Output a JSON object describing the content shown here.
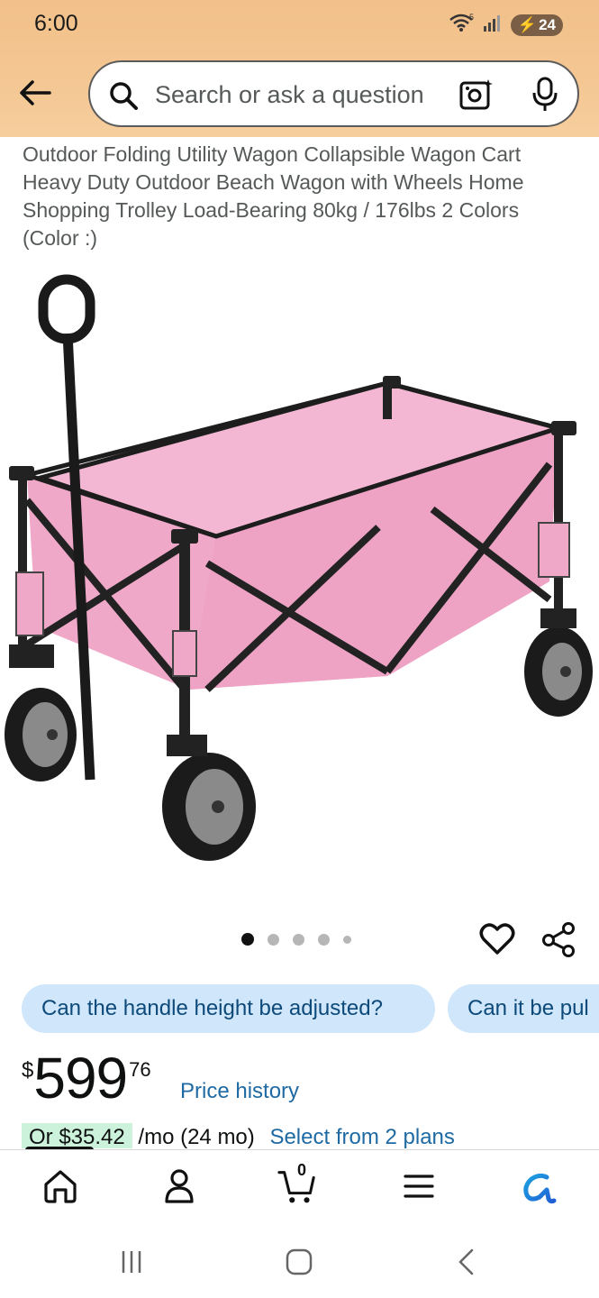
{
  "status_bar": {
    "time": "6:00",
    "wifi_label": "5",
    "battery": "24"
  },
  "search": {
    "placeholder": "Search or ask a question"
  },
  "product": {
    "title": "Outdoor Folding Utility Wagon Collapsible Wagon Cart Heavy Duty Outdoor Beach Wagon with Wheels Home Shopping Trolley Load-Bearing 80kg / 176lbs 2 Colors (Color :)",
    "image_color": "#f0a8c8",
    "image_count": 5,
    "active_image": 1
  },
  "questions": [
    "Can the handle height be adjusted?",
    "Can it be pul"
  ],
  "price": {
    "symbol": "$",
    "whole": "599",
    "fraction": "76",
    "history_label": "Price history"
  },
  "installment": {
    "badge": "Or $35.42",
    "text": "/mo (24 mo)",
    "link": "Select from 2 plans"
  },
  "bottom_nav": {
    "cart_count": "0",
    "items": [
      "home-icon",
      "account-icon",
      "cart-icon",
      "menu-icon",
      "rufus-icon"
    ]
  },
  "colors": {
    "header_bg": "#f2c08a",
    "chip_bg": "#cfe6fb",
    "link": "#1f6aa3",
    "rufus": "#1da1e0"
  }
}
